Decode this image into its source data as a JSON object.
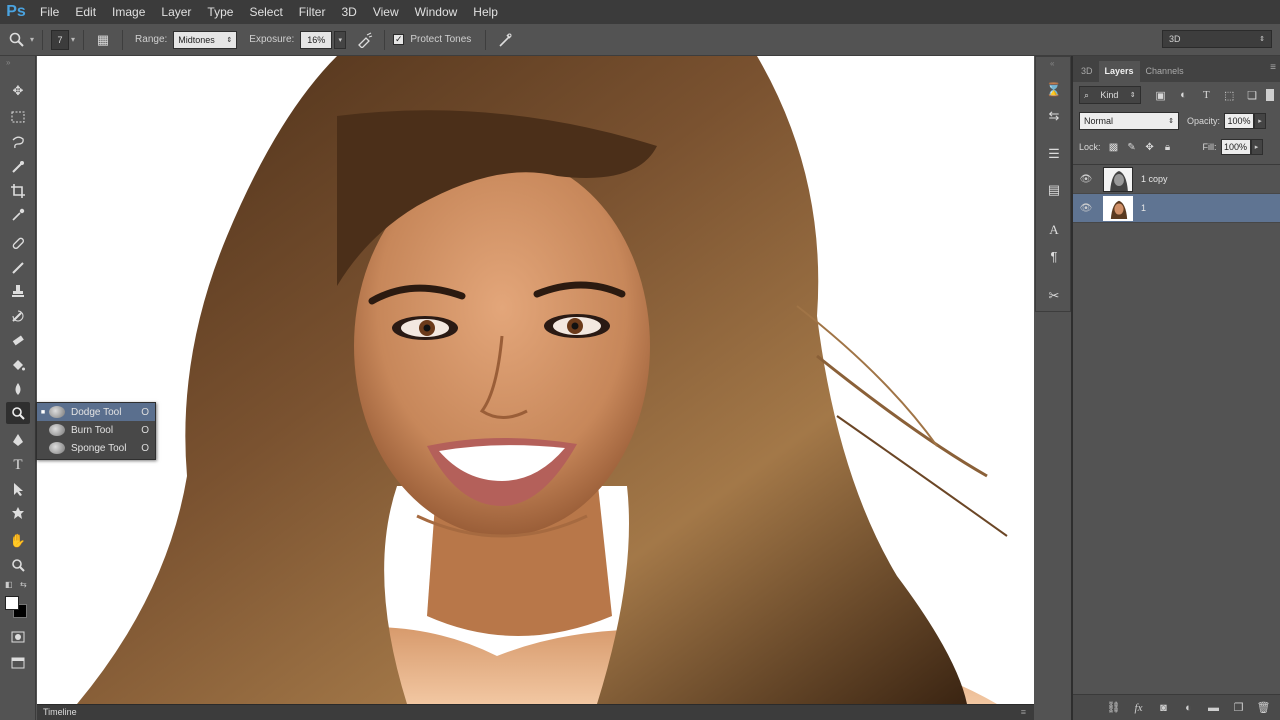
{
  "app": {
    "logo": "Ps"
  },
  "menu": [
    "File",
    "Edit",
    "Image",
    "Layer",
    "Type",
    "Select",
    "Filter",
    "3D",
    "View",
    "Window",
    "Help"
  ],
  "options": {
    "tool_icon": "dodge-icon",
    "brush_size": "7",
    "range_label": "Range:",
    "range_value": "Midtones",
    "exposure_label": "Exposure:",
    "exposure_value": "16%",
    "protect_tones_label": "Protect Tones",
    "protect_tones_checked": true,
    "workspace": "3D"
  },
  "tool_flyout": {
    "items": [
      {
        "label": "Dodge Tool",
        "shortcut": "O",
        "selected": true
      },
      {
        "label": "Burn Tool",
        "shortcut": "O",
        "selected": false
      },
      {
        "label": "Sponge Tool",
        "shortcut": "O",
        "selected": false
      }
    ]
  },
  "colors": {
    "foreground": "#ffffff",
    "background": "#000000",
    "selection": "#5f7492"
  },
  "panel": {
    "tabs": [
      "3D",
      "Layers",
      "Channels"
    ],
    "active_tab": "Layers",
    "filter_kind": "Kind",
    "blend_mode": "Normal",
    "opacity_label": "Opacity:",
    "opacity_value": "100%",
    "lock_label": "Lock:",
    "fill_label": "Fill:",
    "fill_value": "100%",
    "layers": [
      {
        "name": "1 copy",
        "visible": true,
        "selected": false
      },
      {
        "name": "1",
        "visible": true,
        "selected": true
      }
    ]
  },
  "timeline": {
    "label": "Timeline"
  }
}
